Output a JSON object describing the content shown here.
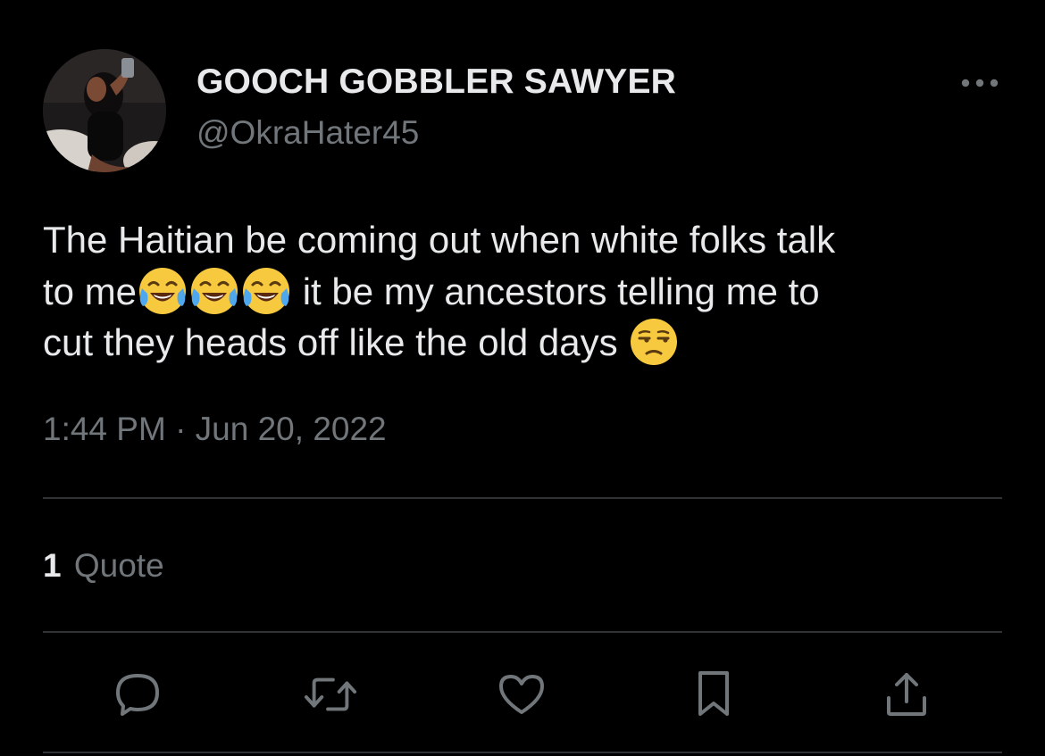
{
  "author": {
    "display_name": "GOOCH GOBBLER SAWYER",
    "handle": "@OkraHater45"
  },
  "tweet": {
    "line1": "The Haitian be coming out when white folks talk",
    "line2_before": "to me",
    "line2_after": " it be my ancestors telling me to",
    "line3": "cut they heads off like the old days ",
    "emojis": [
      "tears-of-joy",
      "tears-of-joy",
      "tears-of-joy",
      "unamused-face"
    ]
  },
  "timestamp": "1:44 PM · Jun 20, 2022",
  "stats": {
    "quote_count": "1",
    "quote_label": "Quote"
  },
  "actions": [
    "reply-icon",
    "retweet-icon",
    "like-icon",
    "bookmark-icon",
    "share-icon"
  ],
  "colors": {
    "background": "#000000",
    "primary_text": "#e7e9ea",
    "secondary_text": "#71767b",
    "divider": "#2f3336"
  }
}
